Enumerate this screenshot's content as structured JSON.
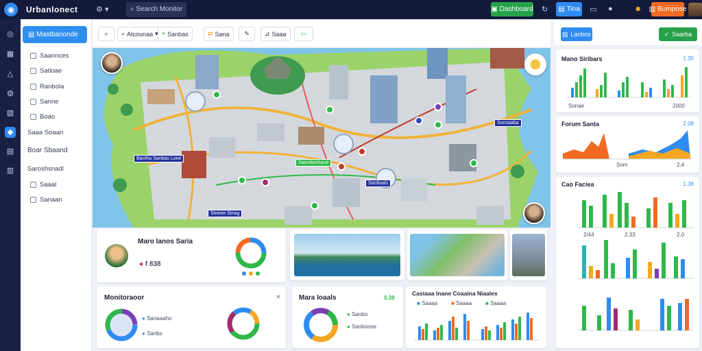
{
  "app": {
    "name": "Urbanlonect",
    "search_placeholder": "Search Monitor"
  },
  "topbar": {
    "btn_green": "Dashboard",
    "btn_blue": "Tina",
    "btn_orange": "Bumpose",
    "icons": [
      "gear-icon",
      "bell-icon",
      "download-icon",
      "chat-icon",
      "alert-icon"
    ]
  },
  "rail": {
    "icons": [
      "home-icon",
      "grid-icon",
      "alert-icon",
      "globe-icon",
      "chart-icon",
      "map-icon",
      "calendar-icon",
      "building-icon"
    ]
  },
  "sidebar": {
    "header": "Mastbanonde",
    "items": [
      {
        "label": "Saannces"
      },
      {
        "label": "Satloae"
      },
      {
        "label": "Ranbola"
      },
      {
        "label": "Sanne"
      },
      {
        "label": "Boao"
      },
      {
        "label": "Saaa Soaan"
      },
      {
        "label": "Boar Sbaand"
      },
      {
        "label": "Saroshsnadl"
      },
      {
        "label": "Saaal"
      },
      {
        "label": "Sanaan"
      }
    ]
  },
  "toolbar": {
    "items": [
      {
        "label": ""
      },
      {
        "label": "Atcounaa"
      },
      {
        "label": "Sanbas"
      },
      {
        "label": "Sana"
      },
      {
        "label": ""
      },
      {
        "label": "Saaa"
      },
      {
        "label": ""
      }
    ]
  },
  "map": {
    "labels": [
      "Bantha Sanbas Lone",
      "Saemborhand",
      "Sanboals",
      "Sonsaaba",
      "Stneee Stnag"
    ]
  },
  "cards": {
    "profile": {
      "title": "Maro Ianos Saria",
      "value": "f 838"
    },
    "monitor": {
      "title": "Monitoraoor",
      "legend": [
        "Sanaaaho",
        "Sanbs"
      ]
    },
    "donut": {
      "title": "Mara Ioaals",
      "badge": "0.38",
      "legend": [
        "Sanbo",
        "Sanboose"
      ]
    },
    "bars": {
      "title": "Castaaa Inane Coaaina Niaales",
      "legend": [
        "Saaaa",
        "Saaaa",
        "Saaaa"
      ]
    }
  },
  "right": {
    "btn_blue": "Lanbos",
    "btn_green": "Saarba",
    "charts": [
      {
        "title": "Mano Siribars",
        "value": "1.35",
        "labels": [
          "Sonae",
          "2000"
        ]
      },
      {
        "title": "Forum Santa",
        "value": "2.08",
        "labels": [
          "Som",
          "2.4"
        ]
      },
      {
        "title": "Cao Faciea",
        "value": "1.38",
        "labels": [
          "2/44",
          "2.33",
          "2.0"
        ]
      }
    ]
  },
  "colors": {
    "primary": "#2e8bf0",
    "green": "#2fb84a",
    "orange": "#f26a21",
    "nav": "#141a3a"
  }
}
